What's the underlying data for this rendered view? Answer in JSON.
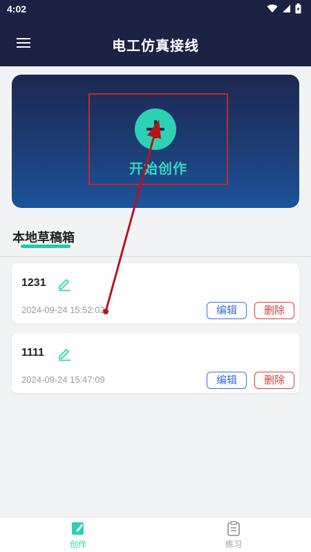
{
  "status": {
    "time": "4:02"
  },
  "header": {
    "title": "电工仿真接线"
  },
  "create": {
    "label": "开始创作"
  },
  "drafts": {
    "title": "本地草稿箱",
    "items": [
      {
        "name": "1231",
        "time": "2024-09-24 15:52:02",
        "edit_label": "编辑",
        "delete_label": "删除"
      },
      {
        "name": "1111",
        "time": "2024-09-24 15:47:09",
        "edit_label": "编辑",
        "delete_label": "删除"
      }
    ]
  },
  "nav": {
    "items": [
      {
        "label": "创作",
        "icon": "edit-icon",
        "active": true
      },
      {
        "label": "练习",
        "icon": "clipboard-icon",
        "active": false
      }
    ]
  },
  "colors": {
    "header_bg": "#1b2244",
    "accent": "#2fd1b4",
    "edit_blue": "#3b6fd6",
    "delete_red": "#d83a3a",
    "annotation_red": "#c62828"
  }
}
